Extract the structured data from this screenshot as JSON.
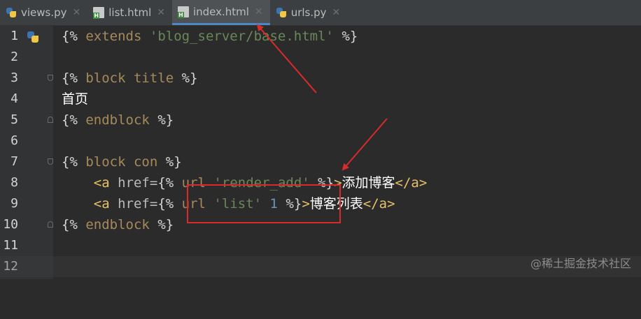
{
  "tabs": [
    {
      "label": "views.py",
      "icon": "python-file-icon",
      "active": false
    },
    {
      "label": "list.html",
      "icon": "html-file-icon",
      "active": false
    },
    {
      "label": "index.html",
      "icon": "html-file-icon",
      "active": true
    },
    {
      "label": "urls.py",
      "icon": "python-file-icon",
      "active": false
    }
  ],
  "close_glyph": "✕",
  "line_numbers": [
    "1",
    "2",
    "3",
    "4",
    "5",
    "6",
    "7",
    "8",
    "9",
    "10",
    "11",
    "12"
  ],
  "code": {
    "l1": {
      "open": "{%",
      "kw": "extends",
      "str": "'blog_server/base.html'",
      "close": "%}"
    },
    "l3": {
      "open": "{%",
      "kw": "block title",
      "close": "%}"
    },
    "l4": {
      "text": "首页"
    },
    "l5": {
      "open": "{%",
      "kw": "endblock",
      "close": "%}"
    },
    "l7": {
      "open": "{%",
      "kw": "block con",
      "close": "%}"
    },
    "l8": {
      "tag_open": "<a",
      "attr": "href=",
      "open": "{%",
      "kw": "url",
      "str": "'render_add'",
      "close": "%}",
      "gt": ">",
      "text": "添加博客",
      "tag_close": "</a>"
    },
    "l9": {
      "tag_open": "<a",
      "attr": "href=",
      "open": "{%",
      "kw": "url",
      "str": "'list'",
      "num": "1",
      "close": "%}",
      "gt": ">",
      "text": "博客列表",
      "tag_close": "</a>"
    },
    "l10": {
      "open": "{%",
      "kw": "endblock",
      "close": "%}"
    }
  },
  "watermark": "@稀土掘金技术社区",
  "colors": {
    "annotation_red": "#d92b2b",
    "active_tab_accent": "#4a88c7"
  }
}
